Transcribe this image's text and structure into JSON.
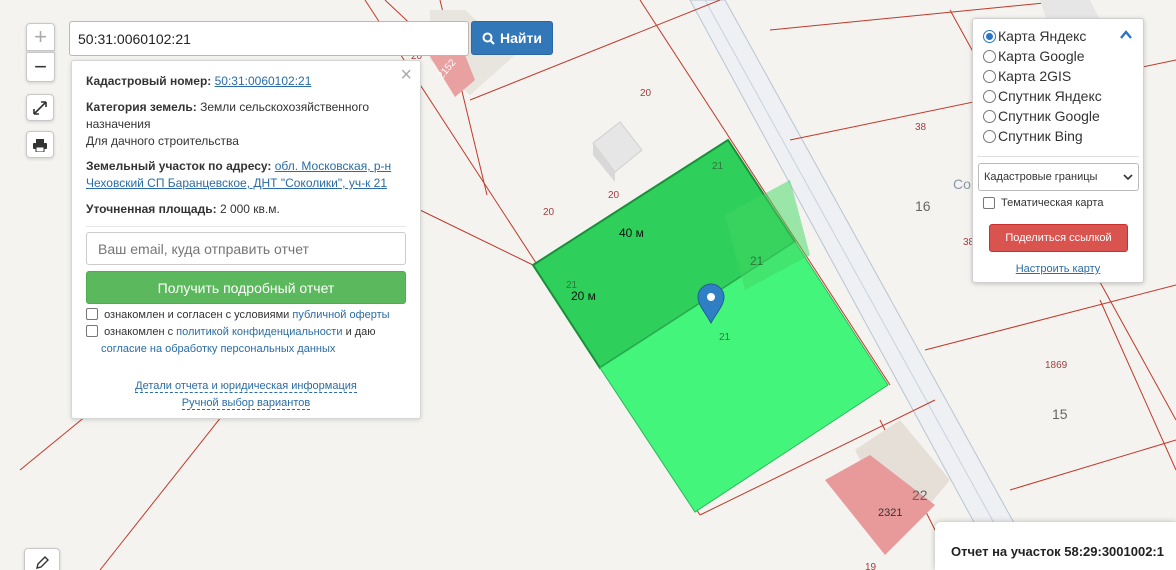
{
  "search": {
    "value": "50:31:0060102:21",
    "button_label": "Найти"
  },
  "zoom": {
    "plus": "+",
    "minus": "−"
  },
  "info": {
    "cadastral_label": "Кадастровый номер:",
    "cadastral_value": "50:31:0060102:21",
    "category_label": "Категория земель:",
    "category_value": "Земли сельскохозяйственного назначения",
    "usage": "Для дачного строительства",
    "address_label": "Земельный участок по адресу:",
    "address_value": "обл. Московская, р-н Чеховский СП Баранцевское, ДНТ \"Соколики\", уч-к 21",
    "area_label": "Уточненная площадь:",
    "area_value": "2 000 кв.м.",
    "email_placeholder": "Ваш email, куда отправить отчет",
    "report_button": "Получить подробный отчет",
    "consent1_text": "ознакомлен и согласен с условиями",
    "consent1_link": "публичной оферты",
    "consent2_text": "ознакомлен с",
    "consent2_link": "политикой конфиденциальности",
    "consent2_tail": "и даю",
    "consent2_link2": "согласие на обработку персональных данных",
    "details_link": "Детали отчета и юридическая информация",
    "manual_link": "Ручной выбор вариантов",
    "close": "×"
  },
  "layers": {
    "options": [
      "Карта Яндекс",
      "Карта Google",
      "Карта 2GIS",
      "Спутник Яндекс",
      "Спутник Google",
      "Спутник Bing"
    ],
    "selected": "Карта Яндекс",
    "select_value": "Кадастровые границы",
    "thematic_label": "Тематическая карта",
    "share_button": "Поделиться ссылкой",
    "configure_link": "Настроить карту"
  },
  "map": {
    "labels": {
      "l_2152": "2152",
      "l_20a": "20",
      "l_20b": "20",
      "l_20c": "20",
      "l_20d": "20",
      "l_21a": "21",
      "l_21b": "21",
      "l_21c": "21",
      "l_21d": "21",
      "l_38a": "38",
      "l_38b": "38",
      "l_16": "16",
      "l_1869": "1869",
      "l_15": "15",
      "l_22": "22",
      "l_2321": "2321",
      "l_19": "19",
      "l_road": "Со"
    },
    "measure_40": "40 м",
    "measure_20": "20 м"
  },
  "report_popup": {
    "title": "Отчет на участок 58:29:3001002:1"
  },
  "colors": {
    "parcel_dark": "#2ecf5a",
    "parcel_light": "#44f57c",
    "boundary": "#c0392b",
    "search_button": "#3277b8",
    "report_button": "#5cb85c",
    "share_button": "#d9534f"
  }
}
